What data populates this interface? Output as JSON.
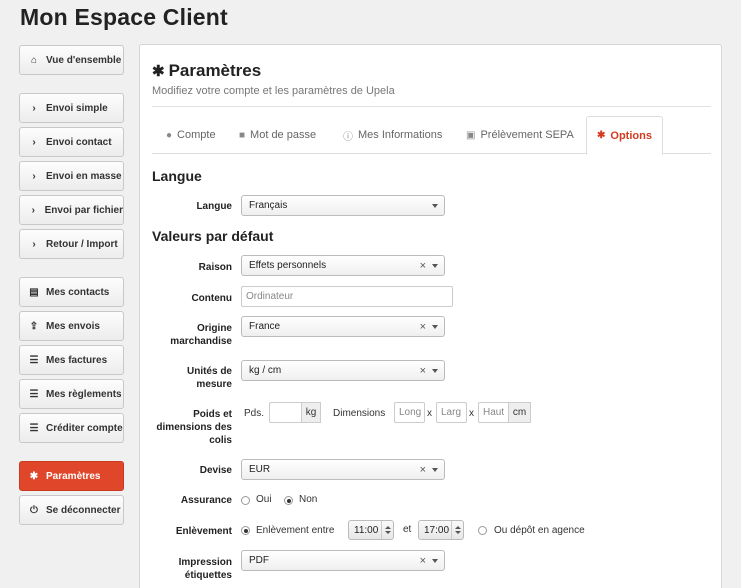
{
  "app": {
    "title": "Mon Espace Client"
  },
  "sidebar": {
    "items": [
      {
        "label": "Vue d'ensemble",
        "icon": "home-icon"
      },
      {
        "label": "Envoi simple",
        "icon": "chevron-right-icon"
      },
      {
        "label": "Envoi contact",
        "icon": "chevron-right-icon"
      },
      {
        "label": "Envoi en masse",
        "icon": "chevron-right-icon"
      },
      {
        "label": "Envoi par fichier",
        "icon": "chevron-right-icon"
      },
      {
        "label": "Retour / Import",
        "icon": "chevron-right-icon"
      },
      {
        "label": "Mes contacts",
        "icon": "book-icon"
      },
      {
        "label": "Mes envois",
        "icon": "upload-icon"
      },
      {
        "label": "Mes factures",
        "icon": "list-icon"
      },
      {
        "label": "Mes règlements",
        "icon": "list-icon"
      },
      {
        "label": "Créditer compte",
        "icon": "list-icon"
      },
      {
        "label": "Paramètres",
        "icon": "gear-icon",
        "active": true
      },
      {
        "label": "Se déconnecter",
        "icon": "power-icon"
      }
    ]
  },
  "panel": {
    "title": "Paramètres",
    "subtitle": "Modifiez votre compte et les paramètres de Upela"
  },
  "tabs": [
    {
      "label": "Compte",
      "icon": "user-icon"
    },
    {
      "label": "Mot de passe",
      "icon": "lock-icon"
    },
    {
      "label": "Mes Informations",
      "icon": "info-icon"
    },
    {
      "label": "Prélèvement SEPA",
      "icon": "image-icon"
    },
    {
      "label": "Options",
      "icon": "gear-icon",
      "active": true
    }
  ],
  "langue_section": {
    "heading": "Langue",
    "label": "Langue",
    "value": "Français"
  },
  "defaults_section": {
    "heading": "Valeurs par défaut",
    "raison": {
      "label": "Raison",
      "value": "Effets personnels"
    },
    "contenu": {
      "label": "Contenu",
      "value": "Ordinateur"
    },
    "origine": {
      "label": "Origine marchandise",
      "value": "France"
    },
    "unites": {
      "label": "Unités de mesure",
      "value": "kg / cm"
    },
    "poids": {
      "label": "Poids et dimensions des colis",
      "pds_label": "Pds.",
      "pds_unit": "kg",
      "dims_label": "Dimensions",
      "long_placeholder": "Long",
      "larg_placeholder": "Larg",
      "haut_placeholder": "Haut",
      "x": "x",
      "dims_unit": "cm"
    },
    "devise": {
      "label": "Devise",
      "value": "EUR"
    },
    "assurance": {
      "label": "Assurance",
      "oui": "Oui",
      "non": "Non",
      "selected": "Non"
    },
    "enlevement": {
      "label": "Enlèvement",
      "option1": "Enlèvement entre",
      "from": "11:00",
      "et": "et",
      "to": "17:00",
      "option2": "Ou dépôt en agence",
      "selected": "option1"
    },
    "impression": {
      "label": "Impression étiquettes",
      "value": "PDF"
    }
  },
  "colors": {
    "accent": "#e0462a",
    "active_tab_text": "#d43a1f"
  }
}
